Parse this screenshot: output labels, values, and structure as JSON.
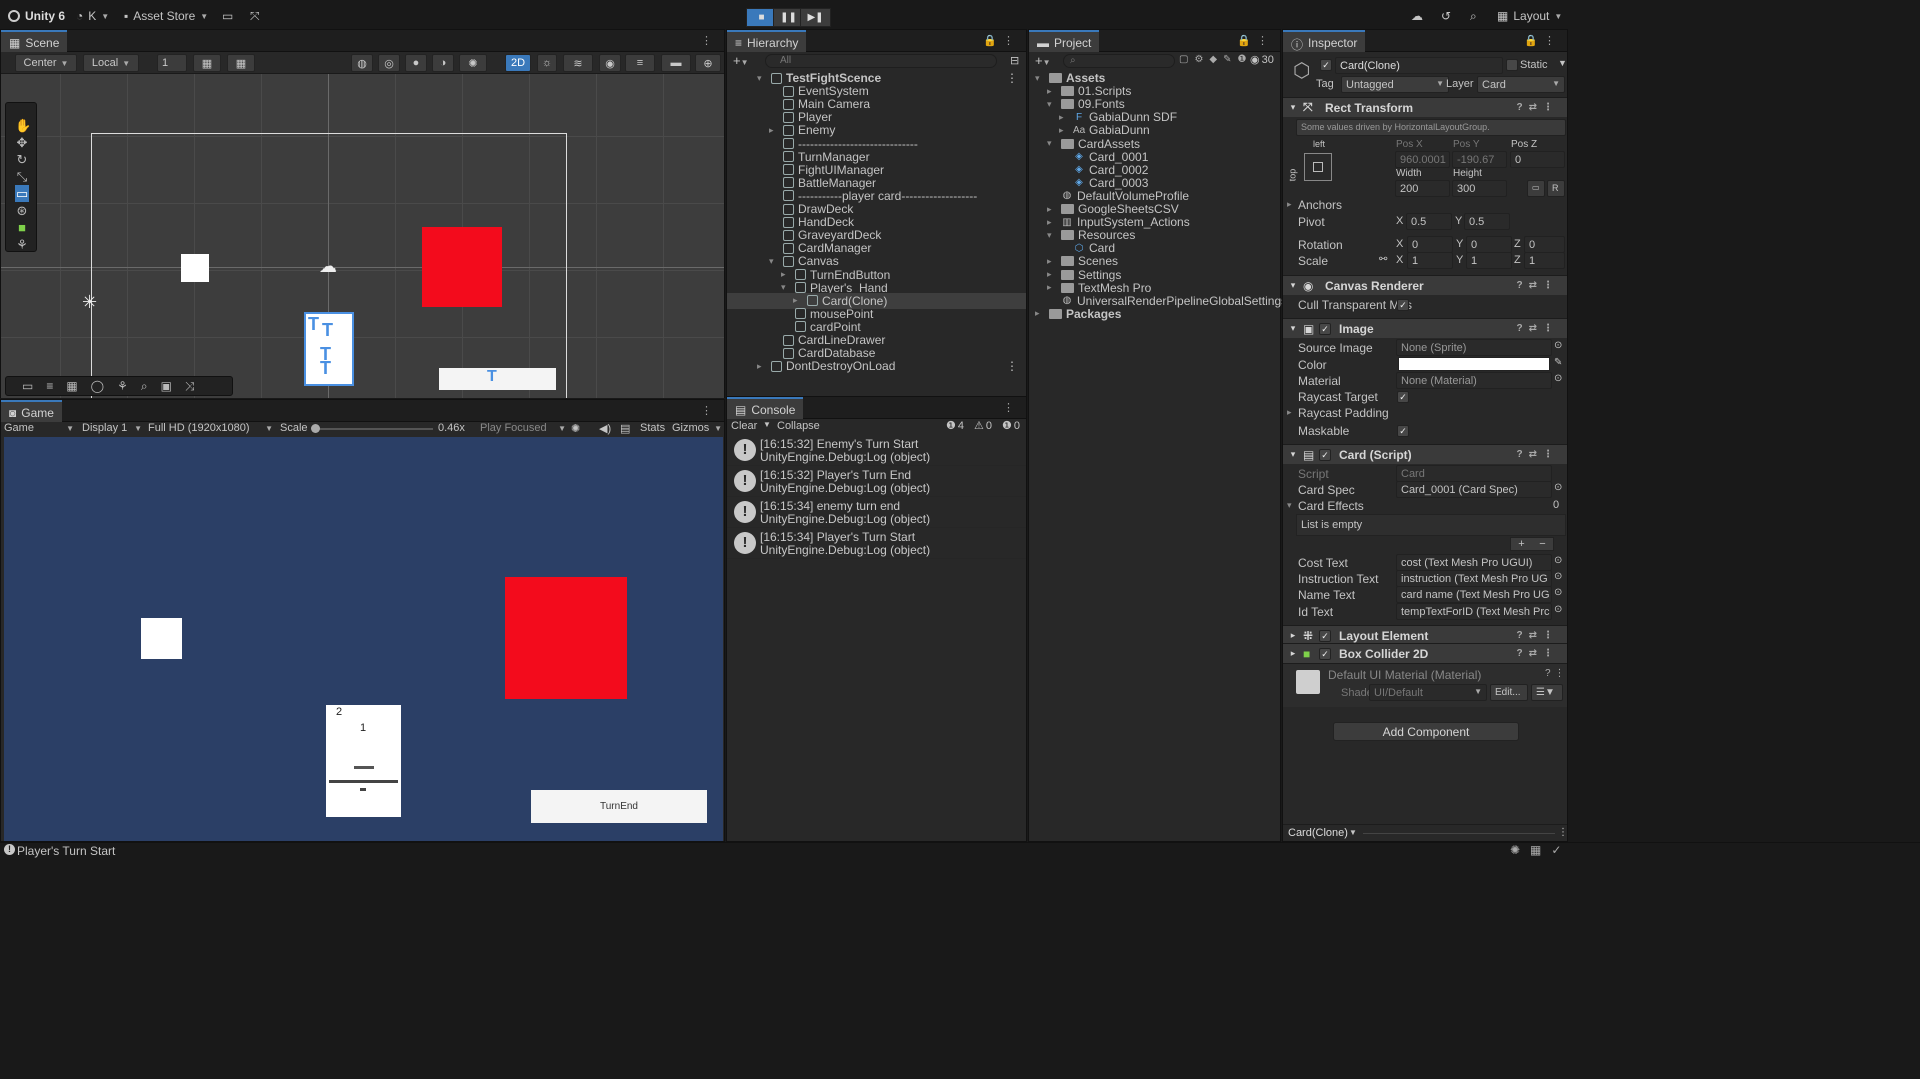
{
  "topbar": {
    "unity_version": "Unity 6",
    "account": "K",
    "asset_store": "Asset Store",
    "layout": "Layout"
  },
  "scene": {
    "tab": "Scene",
    "pivot": "Center",
    "space": "Local",
    "grid_value": "1",
    "mode_2d": "2D"
  },
  "game": {
    "tab": "Game",
    "mode": "Game",
    "display": "Display 1",
    "resolution": "Full HD (1920x1080)",
    "scale_label": "Scale",
    "scale_value": "0.46x",
    "play_focused": "Play Focused",
    "stats": "Stats",
    "gizmos": "Gizmos",
    "card_cost": "2",
    "card_name": "1",
    "turn_end": "TurnEnd"
  },
  "hierarchy": {
    "tab": "Hierarchy",
    "search_placeholder": "All",
    "items": [
      {
        "label": "TestFightScence",
        "depth": 0,
        "bold": true,
        "expand": "▾"
      },
      {
        "label": "EventSystem",
        "depth": 1,
        "expand": ""
      },
      {
        "label": "Main Camera",
        "depth": 1,
        "expand": ""
      },
      {
        "label": "Player",
        "depth": 1,
        "expand": ""
      },
      {
        "label": "Enemy",
        "depth": 1,
        "expand": "▸"
      },
      {
        "label": "------------------------------",
        "depth": 1,
        "expand": ""
      },
      {
        "label": "TurnManager",
        "depth": 1,
        "expand": ""
      },
      {
        "label": "FightUIManager",
        "depth": 1,
        "expand": ""
      },
      {
        "label": "BattleManager",
        "depth": 1,
        "expand": ""
      },
      {
        "label": "-----------player card-------------------",
        "depth": 1,
        "expand": ""
      },
      {
        "label": "DrawDeck",
        "depth": 1,
        "expand": ""
      },
      {
        "label": "HandDeck",
        "depth": 1,
        "expand": ""
      },
      {
        "label": "GraveyardDeck",
        "depth": 1,
        "expand": ""
      },
      {
        "label": "CardManager",
        "depth": 1,
        "expand": ""
      },
      {
        "label": "Canvas",
        "depth": 1,
        "expand": "▾"
      },
      {
        "label": "TurnEndButton",
        "depth": 2,
        "expand": "▸"
      },
      {
        "label": "Player's_Hand",
        "depth": 2,
        "expand": "▾"
      },
      {
        "label": "Card(Clone)",
        "depth": 3,
        "expand": "▸",
        "selected": true
      },
      {
        "label": "mousePoint",
        "depth": 2,
        "expand": ""
      },
      {
        "label": "cardPoint",
        "depth": 2,
        "expand": ""
      },
      {
        "label": "CardLineDrawer",
        "depth": 1,
        "expand": ""
      },
      {
        "label": "CardDatabase",
        "depth": 1,
        "expand": ""
      },
      {
        "label": "DontDestroyOnLoad",
        "depth": 0,
        "expand": "▸"
      }
    ]
  },
  "project": {
    "tab": "Project",
    "count": "30",
    "items": [
      {
        "label": "Assets",
        "depth": 0,
        "expand": "▾",
        "icon": "folder",
        "bold": true
      },
      {
        "label": "01.Scripts",
        "depth": 1,
        "expand": "▸",
        "icon": "folder"
      },
      {
        "label": "09.Fonts",
        "depth": 1,
        "expand": "▾",
        "icon": "folder"
      },
      {
        "label": "GabiaDunn SDF",
        "depth": 2,
        "expand": "▸",
        "icon": "font-asset"
      },
      {
        "label": "GabiaDunn",
        "depth": 2,
        "expand": "▸",
        "icon": "font"
      },
      {
        "label": "CardAssets",
        "depth": 1,
        "expand": "▾",
        "icon": "folder"
      },
      {
        "label": "Card_0001",
        "depth": 2,
        "expand": "",
        "icon": "scriptable"
      },
      {
        "label": "Card_0002",
        "depth": 2,
        "expand": "",
        "icon": "scriptable"
      },
      {
        "label": "Card_0003",
        "depth": 2,
        "expand": "",
        "icon": "scriptable"
      },
      {
        "label": "DefaultVolumeProfile",
        "depth": 1,
        "expand": "",
        "icon": "profile"
      },
      {
        "label": "GoogleSheetsCSV",
        "depth": 1,
        "expand": "▸",
        "icon": "folder"
      },
      {
        "label": "InputSystem_Actions",
        "depth": 1,
        "expand": "▸",
        "icon": "input"
      },
      {
        "label": "Resources",
        "depth": 1,
        "expand": "▾",
        "icon": "folder"
      },
      {
        "label": "Card",
        "depth": 2,
        "expand": "",
        "icon": "prefab"
      },
      {
        "label": "Scenes",
        "depth": 1,
        "expand": "▸",
        "icon": "folder"
      },
      {
        "label": "Settings",
        "depth": 1,
        "expand": "▸",
        "icon": "folder"
      },
      {
        "label": "TextMesh Pro",
        "depth": 1,
        "expand": "▸",
        "icon": "folder"
      },
      {
        "label": "UniversalRenderPipelineGlobalSettings",
        "depth": 1,
        "expand": "",
        "icon": "profile"
      },
      {
        "label": "Packages",
        "depth": 0,
        "expand": "▸",
        "icon": "folder",
        "bold": true
      }
    ]
  },
  "console": {
    "tab": "Console",
    "clear": "Clear",
    "collapse": "Collapse",
    "count_info": "4",
    "count_warn": "0",
    "count_error": "0",
    "entries": [
      {
        "line1": "[16:15:32] Enemy's Turn Start",
        "line2": "UnityEngine.Debug:Log (object)"
      },
      {
        "line1": "[16:15:32] Player's Turn End",
        "line2": "UnityEngine.Debug:Log (object)"
      },
      {
        "line1": "[16:15:34] enemy turn end",
        "line2": "UnityEngine.Debug:Log (object)"
      },
      {
        "line1": "[16:15:34] Player's Turn Start",
        "line2": "UnityEngine.Debug:Log (object)"
      }
    ]
  },
  "inspector": {
    "tab": "Inspector",
    "object_name": "Card(Clone)",
    "static_label": "Static",
    "tag_label": "Tag",
    "tag_value": "Untagged",
    "layer_label": "Layer",
    "layer_value": "Card",
    "rect_transform": {
      "title": "Rect Transform",
      "driven_note": "Some values driven by HorizontalLayoutGroup.",
      "anchor_h": "left",
      "anchor_v": "top",
      "posx_label": "Pos X",
      "posy_label": "Pos Y",
      "posz_label": "Pos Z",
      "posx": "960.0001",
      "posy": "-190.67",
      "posz": "0",
      "width_label": "Width",
      "height_label": "Height",
      "width": "200",
      "height": "300",
      "anchors_label": "Anchors",
      "pivot_label": "Pivot",
      "pivot_x": "0.5",
      "pivot_y": "0.5",
      "rotation_label": "Rotation",
      "rot_x": "0",
      "rot_y": "0",
      "rot_z": "0",
      "scale_label": "Scale",
      "scale_x": "1",
      "scale_y": "1",
      "scale_z": "1",
      "r_label": "R"
    },
    "canvas_renderer": {
      "title": "Canvas Renderer",
      "cull_label": "Cull Transparent Mes"
    },
    "image": {
      "title": "Image",
      "source_label": "Source Image",
      "source_value": "None (Sprite)",
      "color_label": "Color",
      "material_label": "Material",
      "material_value": "None (Material)",
      "raycast_target": "Raycast Target",
      "raycast_padding": "Raycast Padding",
      "maskable": "Maskable"
    },
    "card_script": {
      "title": "Card (Script)",
      "script_label": "Script",
      "script_value": "Card",
      "spec_label": "Card Spec",
      "spec_value": "Card_0001 (Card Spec)",
      "effects_label": "Card Effects",
      "effects_count": "0",
      "list_empty": "List is empty",
      "cost_label": "Cost Text",
      "cost_value": "cost (Text Mesh Pro UGUI)",
      "instruction_label": "Instruction Text",
      "instruction_value": "instruction (Text Mesh Pro UG",
      "name_label": "Name Text",
      "name_value": "card name (Text Mesh Pro UG",
      "id_label": "Id Text",
      "id_value": "tempTextForID (Text Mesh Prc"
    },
    "layout_element": {
      "title": "Layout Element"
    },
    "box_collider": {
      "title": "Box Collider 2D"
    },
    "material": {
      "name": "Default UI Material (Material)",
      "shader_label": "Shader",
      "shader_value": "UI/Default",
      "edit": "Edit..."
    },
    "add_component": "Add Component",
    "footer": "Card(Clone)"
  },
  "statusbar": {
    "message": "Player's Turn Start"
  },
  "colors": {
    "accent": "#3a79bb",
    "game_bg": "#2b3f66",
    "red_block": "#f30b1c",
    "panel": "#282828",
    "selected_row": "#3e3e3e"
  }
}
